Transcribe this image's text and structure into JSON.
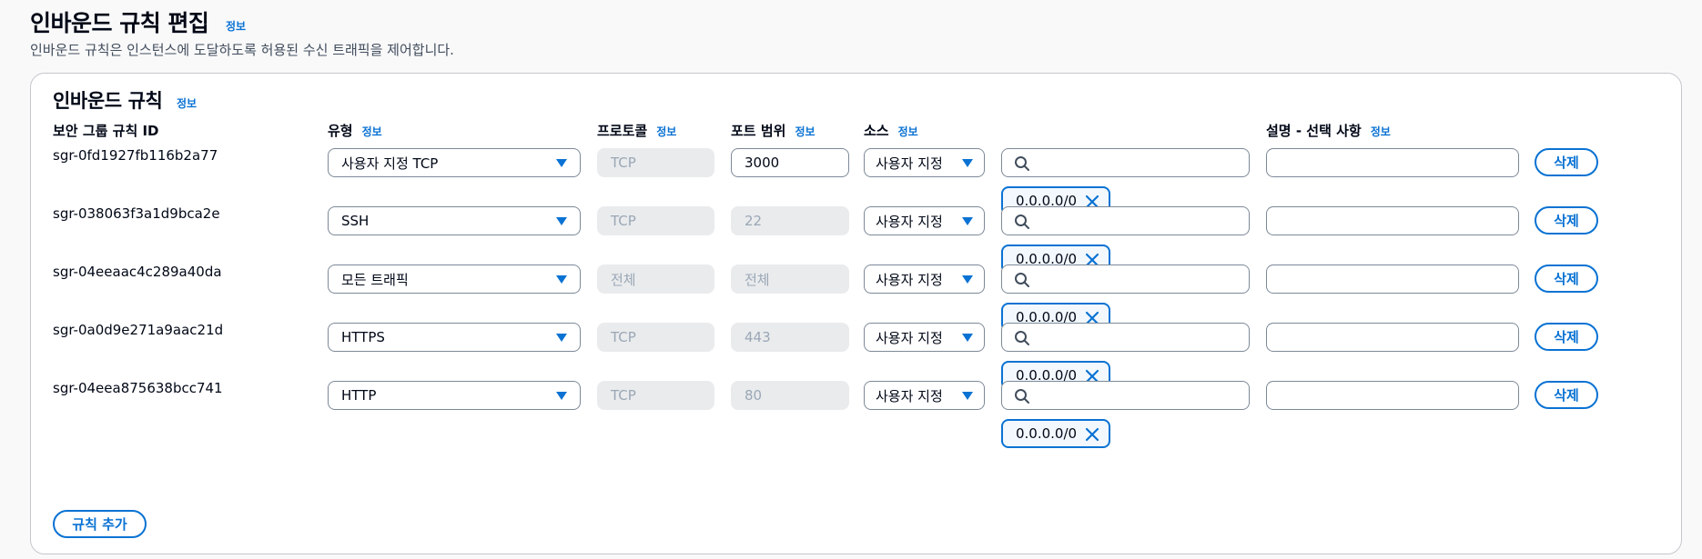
{
  "header": {
    "title": "인바운드 규칙 편집",
    "info_label": "정보",
    "description": "인바운드 규칙은 인스턴스에 도달하도록 허용된 수신 트래픽을 제어합니다."
  },
  "panel": {
    "title": "인바운드 규칙",
    "info_label": "정보",
    "columns": {
      "rule_id": "보안 그룹 규칙 ID",
      "type": "유형",
      "protocol": "프로토콜",
      "port_range": "포트 범위",
      "source": "소스",
      "description": "설명 - 선택 사항"
    },
    "add_rule_label": "규칙 추가"
  },
  "rules": [
    {
      "id": "sgr-0fd1927fb116b2a77",
      "type": "사용자 지정 TCP",
      "protocol": "TCP",
      "port": "3000",
      "port_editable": true,
      "source": "사용자 지정",
      "cidr": "0.0.0.0/0",
      "description": "",
      "delete_label": "삭제"
    },
    {
      "id": "sgr-038063f3a1d9bca2e",
      "type": "SSH",
      "protocol": "TCP",
      "port": "22",
      "port_editable": false,
      "source": "사용자 지정",
      "cidr": "0.0.0.0/0",
      "description": "",
      "delete_label": "삭제"
    },
    {
      "id": "sgr-04eeaac4c289a40da",
      "type": "모든 트래픽",
      "protocol": "전체",
      "port": "전체",
      "port_editable": false,
      "source": "사용자 지정",
      "cidr": "0.0.0.0/0",
      "description": "",
      "delete_label": "삭제"
    },
    {
      "id": "sgr-0a0d9e271a9aac21d",
      "type": "HTTPS",
      "protocol": "TCP",
      "port": "443",
      "port_editable": false,
      "source": "사용자 지정",
      "cidr": "0.0.0.0/0",
      "description": "",
      "delete_label": "삭제"
    },
    {
      "id": "sgr-04eea875638bcc741",
      "type": "HTTP",
      "protocol": "TCP",
      "port": "80",
      "port_editable": false,
      "source": "사용자 지정",
      "cidr": "0.0.0.0/0",
      "description": "",
      "delete_label": "삭제"
    }
  ],
  "colors": {
    "accent": "#0972d3",
    "disabled_bg": "#e9ebed",
    "disabled_text": "#9ba7b6",
    "border": "#7d8998"
  }
}
